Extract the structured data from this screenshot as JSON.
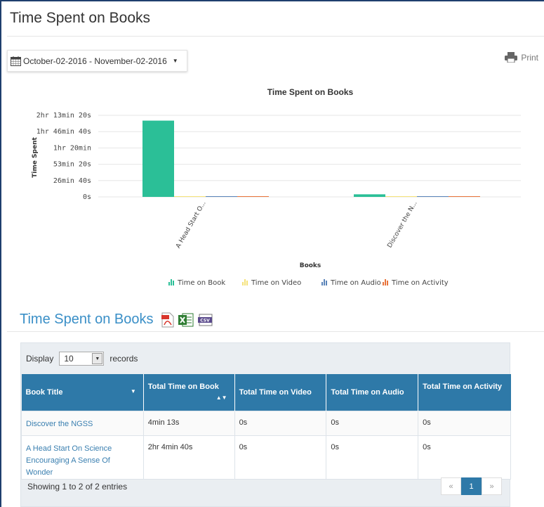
{
  "page": {
    "title": "Time Spent on Books",
    "date_range": "October-02-2016 - November-02-2016",
    "print_label": "Print"
  },
  "chart_data": {
    "type": "bar",
    "title": "Time Spent on Books",
    "xlabel": "Books",
    "ylabel": "Time Spent",
    "categories": [
      "A Head Start O...",
      "Discover the N..."
    ],
    "y_ticks": [
      "0s",
      "26min 40s",
      "53min 20s",
      "1hr 20min",
      "1hr 46min 40s",
      "2hr 13min 20s"
    ],
    "ylim_seconds": [
      0,
      8000
    ],
    "series": [
      {
        "name": "Time on Book",
        "color": "#2bbf97",
        "values": [
          7480,
          253
        ]
      },
      {
        "name": "Time on Video",
        "color": "#f5e27a",
        "values": [
          0,
          0
        ]
      },
      {
        "name": "Time on Audio",
        "color": "#5b84b9",
        "values": [
          0,
          0
        ]
      },
      {
        "name": "Time on Activity",
        "color": "#e8743b",
        "values": [
          0,
          0
        ]
      }
    ],
    "legend_position": "bottom"
  },
  "report": {
    "section_title": "Time Spent on Books",
    "export_icons": [
      "pdf-icon",
      "excel-icon",
      "csv-icon"
    ],
    "display_label": "Display",
    "display_value": "10",
    "records_label": "records",
    "columns": [
      "Book Title",
      "Total Time on Book",
      "Total Time on Video",
      "Total Time on Audio",
      "Total Time on Activity"
    ],
    "rows": [
      {
        "title": "Discover the NGSS",
        "book": "4min 13s",
        "video": "0s",
        "audio": "0s",
        "activity": "0s"
      },
      {
        "title": "A Head Start On Science Encouraging A Sense Of Wonder",
        "book": "2hr 4min 40s",
        "video": "0s",
        "audio": "0s",
        "activity": "0s"
      }
    ],
    "showing_text": "Showing 1 to 2 of 2 entries",
    "pager": {
      "prev": "«",
      "current": "1",
      "next": "»"
    }
  }
}
